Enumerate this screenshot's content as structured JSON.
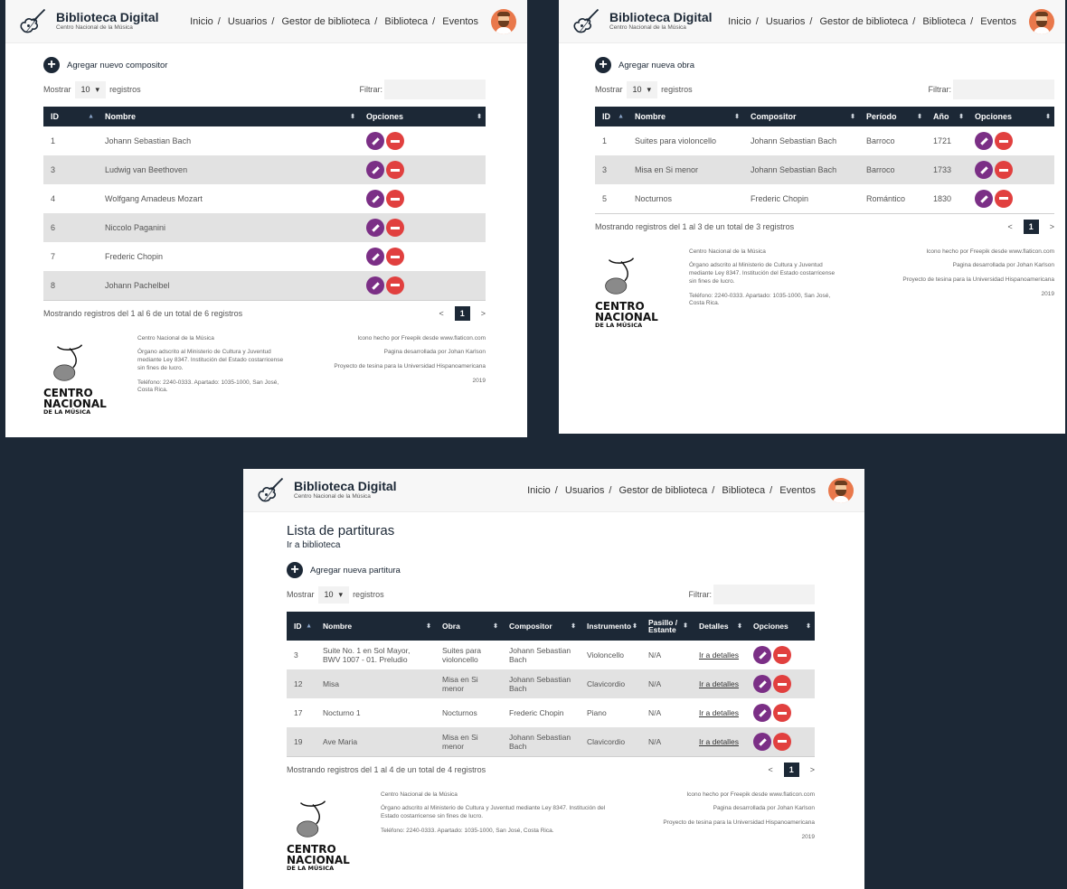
{
  "brand": {
    "title": "Biblioteca Digital",
    "subtitle": "Centro Nacional de la Música"
  },
  "nav": [
    "Inicio",
    "Usuarios",
    "Gestor de biblioteca",
    "Biblioteca",
    "Eventos"
  ],
  "common": {
    "show_label": "Mostrar",
    "show_value": "10",
    "records_label": "registros",
    "filter_label": "Filtrar:",
    "page_current": "1",
    "page_prev": "<",
    "page_next": ">"
  },
  "footer": {
    "logo_l1": "CENTRO",
    "logo_l2": "NACIONAL",
    "logo_l3": "DE LA MÚSICA",
    "org": "Centro Nacional de la Música",
    "desc": "Órgano adscrito al Ministerio de Cultura y Juventud mediante Ley 8347. Institución del Estado costarricense sin fines de lucro.",
    "contact": "Teléfono: 2240-0333. Apartado: 1035-1000, San José, Costa Rica.",
    "icons": "Icono hecho por Freepik desde www.flaticon.com",
    "dev": "Pagina desarrollada por Johan Karlson",
    "project": "Proyecto de tesina para la Universidad Hispanoamericana",
    "year": "2019"
  },
  "composers": {
    "add_label": "Agregar nuevo compositor",
    "columns": [
      "ID",
      "Nombre",
      "Opciones"
    ],
    "rows": [
      {
        "id": "1",
        "name": "Johann Sebastian Bach"
      },
      {
        "id": "3",
        "name": "Ludwig van Beethoven"
      },
      {
        "id": "4",
        "name": "Wolfgang Amadeus Mozart"
      },
      {
        "id": "6",
        "name": "Niccolo Paganini"
      },
      {
        "id": "7",
        "name": "Frederic Chopin"
      },
      {
        "id": "8",
        "name": "Johann Pachelbel"
      }
    ],
    "summary": "Mostrando registros del 1 al 6 de un total de 6 registros"
  },
  "works": {
    "add_label": "Agregar nueva obra",
    "columns": [
      "ID",
      "Nombre",
      "Compositor",
      "Período",
      "Año",
      "Opciones"
    ],
    "rows": [
      {
        "id": "1",
        "name": "Suites para violoncello",
        "composer": "Johann Sebastian Bach",
        "period": "Barroco",
        "year": "1721"
      },
      {
        "id": "3",
        "name": "Misa en Si menor",
        "composer": "Johann Sebastian Bach",
        "period": "Barroco",
        "year": "1733"
      },
      {
        "id": "5",
        "name": "Nocturnos",
        "composer": "Frederic Chopin",
        "period": "Romántico",
        "year": "1830"
      }
    ],
    "summary": "Mostrando registros del 1 al 3 de un total de 3 registros"
  },
  "scores": {
    "title": "Lista de partituras",
    "library_link": "Ir a biblioteca",
    "add_label": "Agregar nueva partitura",
    "columns": [
      "ID",
      "Nombre",
      "Obra",
      "Compositor",
      "Instrumento",
      "Pasillo / Estante",
      "Detalles",
      "Opciones"
    ],
    "rows": [
      {
        "id": "3",
        "name": "Suite No. 1 en Sol Mayor, BWV 1007 - 01. Preludio",
        "work": "Suites para violoncello",
        "composer": "Johann Sebastian Bach",
        "instrument": "Violoncello",
        "shelf": "N/A",
        "details": "Ir a detalles"
      },
      {
        "id": "12",
        "name": "Misa",
        "work": "Misa en Si menor",
        "composer": "Johann Sebastian Bach",
        "instrument": "Clavicordio",
        "shelf": "N/A",
        "details": "Ir a detalles"
      },
      {
        "id": "17",
        "name": "Nocturno 1",
        "work": "Nocturnos",
        "composer": "Frederic Chopin",
        "instrument": "Piano",
        "shelf": "N/A",
        "details": "Ir a detalles"
      },
      {
        "id": "19",
        "name": "Ave Maria",
        "work": "Misa en Si menor",
        "composer": "Johann Sebastian Bach",
        "instrument": "Clavicordio",
        "shelf": "N/A",
        "details": "Ir a detalles"
      }
    ],
    "summary": "Mostrando registros del 1 al 4 de un total de 4 registros"
  }
}
